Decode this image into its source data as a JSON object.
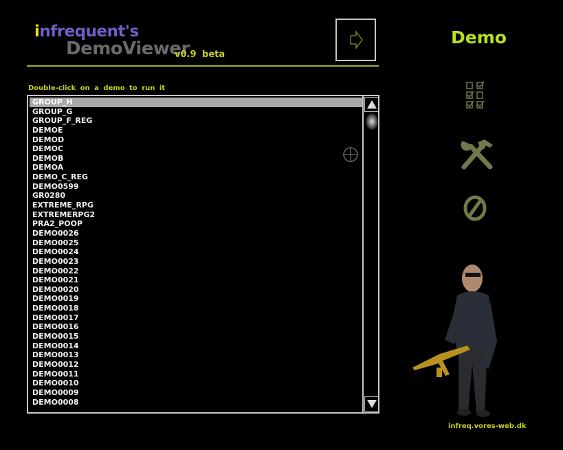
{
  "header": {
    "logo_i": "i",
    "logo_rest": "nfrequent's",
    "logo_line2": "DemoViewer",
    "version": "v0.9 beta"
  },
  "hint": "Double-click on a demo to run it",
  "demos": [
    "GROUP_H",
    "GROUP_G",
    "GROUP_F_REG",
    "DEMOE",
    "DEMOD",
    "DEMOC",
    "DEMOB",
    "DEMOA",
    "DEMO_C_REG",
    "DEMO0599",
    "GR0280",
    "EXTREME_RPG",
    "EXTREMERPG2",
    "PRA2_POOP",
    "DEMO0026",
    "DEMO0025",
    "DEMO0024",
    "DEMO0023",
    "DEMO0022",
    "DEMO0021",
    "DEMO0020",
    "DEMO0019",
    "DEMO0018",
    "DEMO0017",
    "DEMO0016",
    "DEMO0015",
    "DEMO0014",
    "DEMO0013",
    "DEMO0012",
    "DEMO0011",
    "DEMO0010",
    "DEMO0009",
    "DEMO0008"
  ],
  "selected_index": 0,
  "sidebar": {
    "title": "Demo",
    "url": "infreq.vores-web.dk"
  },
  "colors": {
    "accent": "#c8d020",
    "title": "#b8e020",
    "icon": "#6f7a4a"
  }
}
